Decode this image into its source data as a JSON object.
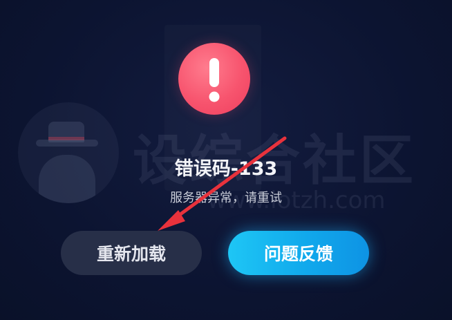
{
  "error": {
    "code": "错误码-133",
    "message": "服务器异常，请重试"
  },
  "buttons": {
    "reload_label": "重新加载",
    "feedback_label": "问题反馈"
  },
  "watermark": {
    "text": "设综合社区",
    "url": "www.iotzh.com"
  },
  "colors": {
    "background": "#0d1533",
    "error_icon": "#f7546e",
    "reload_button": "#272f48",
    "feedback_button": "#11a9ec",
    "annotation_arrow": "#e8323c"
  },
  "icons": {
    "error": "exclamation-circle-icon",
    "annotation": "red-arrow-annotation"
  }
}
